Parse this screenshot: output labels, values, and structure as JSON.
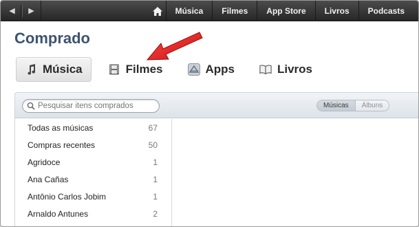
{
  "topbar": {
    "back_icon": "back-arrow-icon",
    "forward_icon": "forward-arrow-icon",
    "home_icon": "home-icon",
    "links": [
      "Música",
      "Filmes",
      "App Store",
      "Livros",
      "Podcasts"
    ]
  },
  "page": {
    "title": "Comprado"
  },
  "categories": [
    {
      "label": "Música",
      "icon": "music-note-icon",
      "active": true
    },
    {
      "label": "Filmes",
      "icon": "film-icon",
      "active": false
    },
    {
      "label": "Apps",
      "icon": "apps-icon",
      "active": false
    },
    {
      "label": "Livros",
      "icon": "book-icon",
      "active": false
    }
  ],
  "annotation": {
    "icon": "red-arrow-icon",
    "color": "#e41e1e"
  },
  "search": {
    "placeholder": "Pesquisar itens comprados"
  },
  "view_toggle": {
    "options": [
      "Músicas",
      "Álbuns"
    ],
    "selected": "Músicas"
  },
  "list": [
    {
      "label": "Todas as músicas",
      "count": "67"
    },
    {
      "label": "Compras recentes",
      "count": "50"
    },
    {
      "label": "Agridoce",
      "count": "1"
    },
    {
      "label": "Ana Cañas",
      "count": "1"
    },
    {
      "label": "Antônio Carlos Jobim",
      "count": "1"
    },
    {
      "label": "Arnaldo Antunes",
      "count": "2"
    }
  ],
  "colors": {
    "title": "#3d5370",
    "topbar": "#333333",
    "accent_arrow": "#e41e1e"
  }
}
